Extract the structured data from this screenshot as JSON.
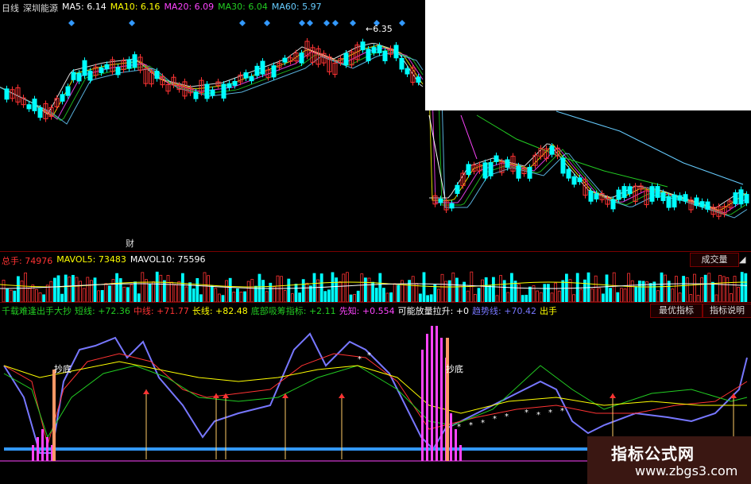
{
  "main_chart": {
    "period": "日线",
    "stock": "深圳能源",
    "ma": [
      {
        "label": "MA5:",
        "value": "6.14",
        "color": "#ffffff"
      },
      {
        "label": "MA10:",
        "value": "6.16",
        "color": "#ffff00"
      },
      {
        "label": "MA20:",
        "value": "6.09",
        "color": "#ff44ff"
      },
      {
        "label": "MA30:",
        "value": "6.04",
        "color": "#22cc22"
      },
      {
        "label": "MA60:",
        "value": "5.97",
        "color": "#66ccff"
      }
    ],
    "high_marker": "6.35",
    "cai_label": "财"
  },
  "volume_panel": {
    "total_label": "总手:",
    "total_value": "74976",
    "mavol5_label": "MAVOL5:",
    "mavol5_value": "73483",
    "mavol10_label": "MAVOL10:",
    "mavol10_value": "75596",
    "button": "成交量"
  },
  "indicator_panel": {
    "name": "千载难逢出手大抄",
    "items": [
      {
        "label": "短线:",
        "value": "+72.36",
        "color": "#22cc22"
      },
      {
        "label": "中线:",
        "value": "+71.77",
        "color": "#ff3333"
      },
      {
        "label": "长线:",
        "value": "+82.48",
        "color": "#ffff00"
      },
      {
        "label": "底部吸筹指标:",
        "value": "+2.11",
        "color": "#22cc22"
      },
      {
        "label": "先知:",
        "value": "+0.554",
        "color": "#ff44ff"
      },
      {
        "label": "可能放量拉升:",
        "value": "+0",
        "color": "#ffffff"
      },
      {
        "label": "趋势线:",
        "value": "+70.42",
        "color": "#7777ff"
      }
    ],
    "last_label": "出手",
    "btn_best": "最优指标",
    "btn_help": "指标说明",
    "buy_label": "抄底"
  },
  "watermark": {
    "line1": "指标公式网",
    "line2": "www.zbgs3.com"
  },
  "colors": {
    "up": "#ff3333",
    "down": "#00ffff",
    "border": "#7a0000"
  }
}
